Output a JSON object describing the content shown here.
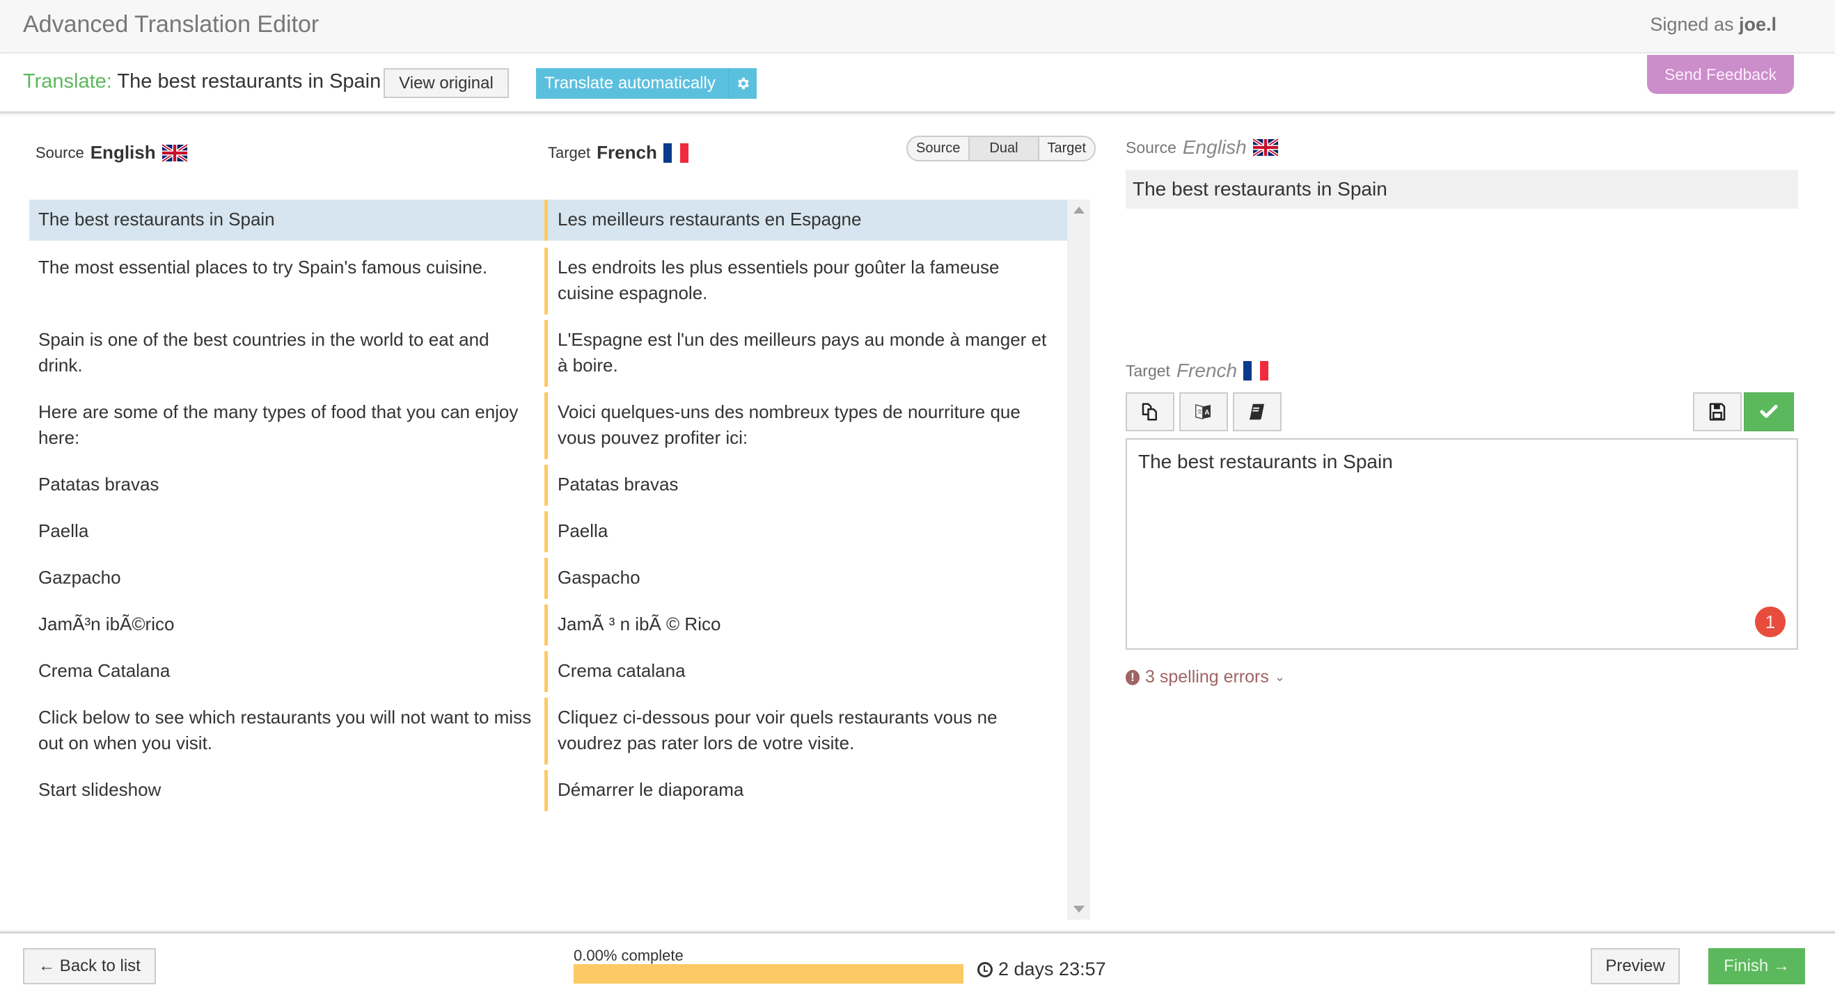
{
  "header": {
    "app_title": "Advanced Translation Editor",
    "signed_prefix": "Signed as",
    "username": "joe.l"
  },
  "subheader": {
    "translate_label": "Translate:",
    "document_title": "The best restaurants in Spain",
    "view_original": "View original",
    "translate_auto": "Translate automatically",
    "send_feedback": "Send Feedback"
  },
  "columns": {
    "source_label": "Source",
    "source_lang": "English",
    "target_label": "Target",
    "target_lang": "French"
  },
  "view_toggle": {
    "options": [
      "Source",
      "Dual",
      "Target"
    ],
    "selected": "Dual"
  },
  "segments": [
    {
      "source": "The best restaurants in Spain",
      "target": "Les meilleurs restaurants en Espagne",
      "active": true
    },
    {
      "source": "The most essential places to try Spain's famous cuisine.",
      "target": "Les endroits les plus essentiels pour goûter la fameuse cuisine espagnole."
    },
    {
      "source": "Spain is one of the best countries in the world to eat and drink.",
      "target": "L'Espagne est l'un des meilleurs pays au monde à manger et à boire."
    },
    {
      "source": "Here are some of the many types of food that you can enjoy here:",
      "target": "Voici quelques-uns des nombreux types de nourriture que vous pouvez profiter ici:"
    },
    {
      "source": "Patatas bravas",
      "target": "Patatas bravas"
    },
    {
      "source": "Paella",
      "target": "Paella"
    },
    {
      "source": "Gazpacho",
      "target": "Gaspacho"
    },
    {
      "source": "JamÃ³n ibÃ©rico",
      "target": "JamÃ ³ n ibÃ © Rico"
    },
    {
      "source": "Crema Catalana",
      "target": "Crema catalana"
    },
    {
      "source": "Click below to see which restaurants you will not want to miss out on when you visit.",
      "target": "Cliquez ci-dessous pour voir quels restaurants vous ne voudrez pas rater lors de votre visite."
    },
    {
      "source": "Start slideshow",
      "target": "Démarrer le diaporama"
    }
  ],
  "detail": {
    "source_label": "Source",
    "source_lang": "English",
    "source_text": "The best restaurants in Spain",
    "target_label": "Target",
    "target_lang": "French",
    "target_text": "The best restaurants in Spain",
    "error_count": "1",
    "spelling_errors": "3 spelling errors",
    "tools": [
      "copy-source-icon",
      "machine-translate-icon",
      "glossary-book-icon"
    ]
  },
  "footer": {
    "back": "← Back to list",
    "progress_label": "0.00% complete",
    "progress_percent": 0,
    "deadline": "2 days 23:57",
    "preview": "Preview",
    "finish": "Finish →"
  },
  "colors": {
    "accent_green": "#5cb85c",
    "info_blue": "#5bc0de",
    "feedback_purple": "#cc8dcb",
    "segment_marker": "#fdc964",
    "active_row": "#d6e5ef",
    "error_red": "#e74c3c"
  }
}
